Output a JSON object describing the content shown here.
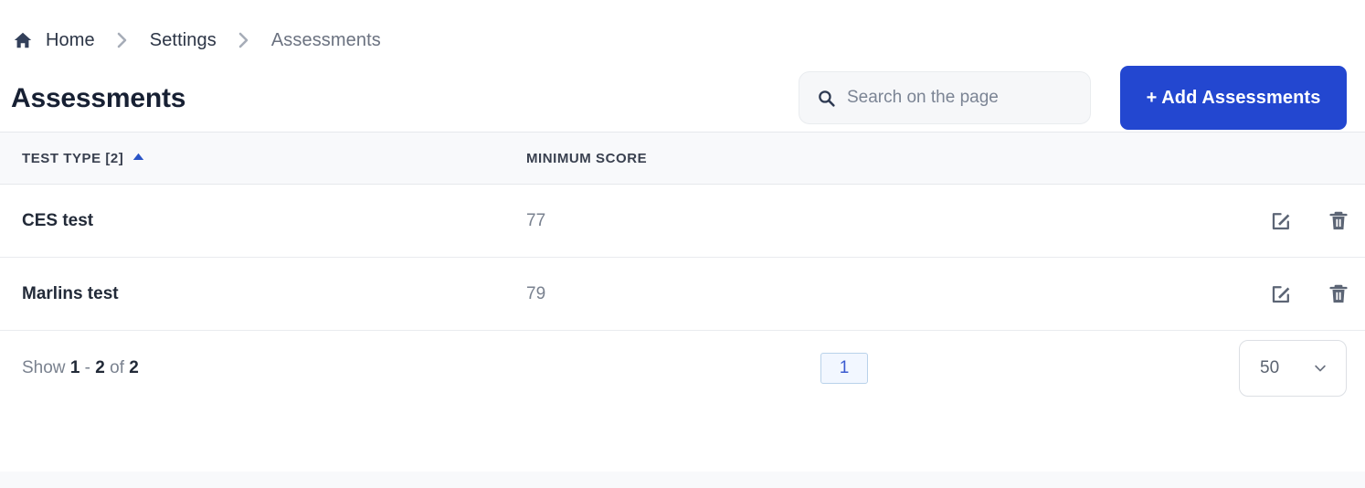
{
  "breadcrumb": {
    "home_icon": "home-icon",
    "separator_icon": "chevron-right-icon",
    "items": [
      {
        "label": "Home"
      },
      {
        "label": "Settings"
      },
      {
        "label": "Assessments"
      }
    ]
  },
  "header": {
    "title": "Assessments",
    "search": {
      "icon": "search-icon",
      "placeholder": "Search on the page",
      "value": ""
    },
    "add_button": {
      "label": "+ Add Assessments",
      "color": "#2347d0"
    }
  },
  "table": {
    "columns": [
      {
        "label": "TEST TYPE [2]",
        "sort": "asc",
        "sort_icon": "triangle-up-icon",
        "sort_color": "#2a54c6"
      },
      {
        "label": "MINIMUM SCORE"
      }
    ],
    "rows": [
      {
        "test_type": "CES test",
        "minimum_score": "77",
        "edit_icon": "edit-icon",
        "delete_icon": "trash-icon"
      },
      {
        "test_type": "Marlins test",
        "minimum_score": "79",
        "edit_icon": "edit-icon",
        "delete_icon": "trash-icon"
      }
    ]
  },
  "footer": {
    "show_prefix": "Show",
    "range_start": "1",
    "range_dash": "-",
    "range_end": "2",
    "of_word": "of",
    "total": "2",
    "pagination": {
      "pages": [
        {
          "label": "1",
          "active": true
        }
      ]
    },
    "per_page": {
      "value": "50",
      "icon": "chevron-down-icon"
    }
  }
}
